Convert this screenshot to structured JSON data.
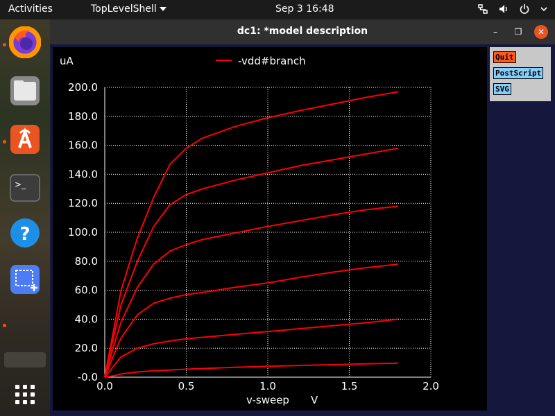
{
  "topbar": {
    "activities": "Activities",
    "app_name": "TopLevelShell",
    "clock": "Sep 3  16:48",
    "tray_icons": [
      "network-icon",
      "volume-icon",
      "power-icon",
      "chevron-down-icon"
    ]
  },
  "dock": {
    "items": [
      "firefox",
      "files",
      "software",
      "terminal",
      "help",
      "screenshot"
    ],
    "apps_grid_icon": "apps-grid-icon"
  },
  "window": {
    "title": "dc1: *model description",
    "minimize_glyph": "–",
    "maximize_glyph": "❐",
    "close_glyph": "✕"
  },
  "buttons": {
    "quit": "Quit",
    "postscript": "PostScript",
    "svg": "SVG"
  },
  "colors": {
    "plot_bg": "#000000",
    "grid": "#ffffff",
    "trace": "#ff0000",
    "accent": "#e95420"
  },
  "chart_data": {
    "type": "line",
    "ylabel": "uA",
    "xlabel": "v-sweep",
    "xunit": "V",
    "xlim": [
      0.0,
      2.0
    ],
    "ylim": [
      0.0,
      200.0
    ],
    "x_ticks": [
      "0.0",
      "0.5",
      "1.0",
      "1.5",
      "2.0"
    ],
    "y_ticks": [
      "-0.0",
      "20.0",
      "40.0",
      "60.0",
      "80.0",
      "100.0",
      "120.0",
      "140.0",
      "160.0",
      "180.0",
      "200.0"
    ],
    "grid": true,
    "legend_position": "top-center",
    "series": [
      {
        "name": "-vdd#branch",
        "x": [
          0,
          0.05,
          0.1,
          0.2,
          0.3,
          0.4,
          0.5,
          0.6,
          0.8,
          1.0,
          1.2,
          1.4,
          1.6,
          1.8
        ],
        "y": [
          0,
          0.8,
          2.2,
          3.6,
          4.4,
          5.0,
          5.5,
          6.0,
          6.8,
          7.5,
          8.1,
          8.6,
          9.2,
          9.7
        ]
      },
      {
        "x": [
          0,
          0.05,
          0.1,
          0.2,
          0.3,
          0.4,
          0.5,
          0.6,
          0.8,
          1.0,
          1.2,
          1.4,
          1.6,
          1.8
        ],
        "y": [
          0,
          7,
          14,
          20,
          23,
          25,
          26.5,
          27.5,
          29.5,
          31.5,
          33.5,
          35.5,
          37.5,
          40
        ]
      },
      {
        "x": [
          0,
          0.05,
          0.1,
          0.2,
          0.3,
          0.4,
          0.5,
          0.6,
          0.8,
          1.0,
          1.2,
          1.4,
          1.6,
          1.8
        ],
        "y": [
          0,
          14,
          27,
          43,
          51,
          54.5,
          57,
          58.5,
          62,
          65,
          69,
          72.5,
          75.5,
          78
        ]
      },
      {
        "x": [
          0,
          0.05,
          0.1,
          0.2,
          0.3,
          0.4,
          0.5,
          0.6,
          0.8,
          1.0,
          1.2,
          1.4,
          1.6,
          1.8
        ],
        "y": [
          0,
          20,
          38,
          62,
          78,
          87,
          91.5,
          95,
          99.5,
          104,
          108,
          112,
          115.5,
          118
        ]
      },
      {
        "x": [
          0,
          0.05,
          0.1,
          0.2,
          0.3,
          0.4,
          0.5,
          0.6,
          0.8,
          1.0,
          1.2,
          1.4,
          1.6,
          1.8
        ],
        "y": [
          0,
          26,
          50,
          80,
          104,
          119,
          126,
          130,
          136,
          141,
          146,
          150,
          154,
          158
        ]
      },
      {
        "x": [
          0,
          0.05,
          0.1,
          0.2,
          0.3,
          0.4,
          0.5,
          0.6,
          0.8,
          1.0,
          1.2,
          1.4,
          1.6,
          1.8
        ],
        "y": [
          0,
          30,
          60,
          96,
          124,
          147,
          158,
          165,
          173,
          179,
          184,
          188.5,
          193,
          197
        ]
      }
    ]
  }
}
